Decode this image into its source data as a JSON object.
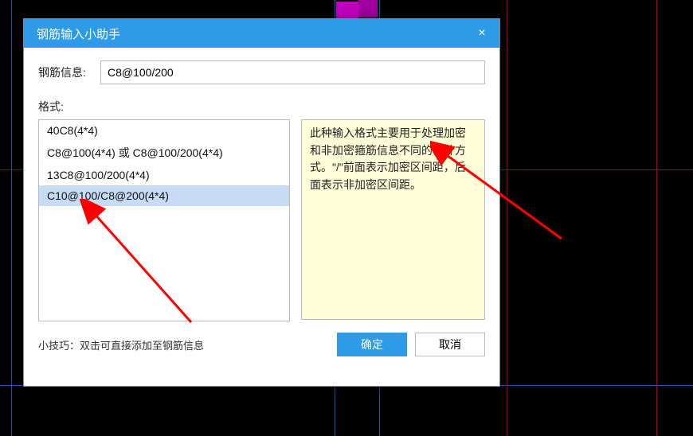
{
  "dialog": {
    "title": "钢筋输入小助手",
    "close_icon": "×",
    "info_label": "钢筋信息:",
    "info_value": "C8@100/200",
    "format_label": "格式:",
    "format_items": [
      "40C8(4*4)",
      "C8@100(4*4) 或 C8@100/200(4*4)",
      "13C8@100/200(4*4)",
      "C10@100/C8@200(4*4)"
    ],
    "selected_index": 3,
    "description": "此种输入格式主要用于处理加密和非加密箍筋信息不同的设计方式。\"/\"前面表示加密区间距，后面表示非加密区间距。",
    "tip": "小技巧：双击可直接添加至钢筋信息",
    "ok_label": "确定",
    "cancel_label": "取消"
  }
}
